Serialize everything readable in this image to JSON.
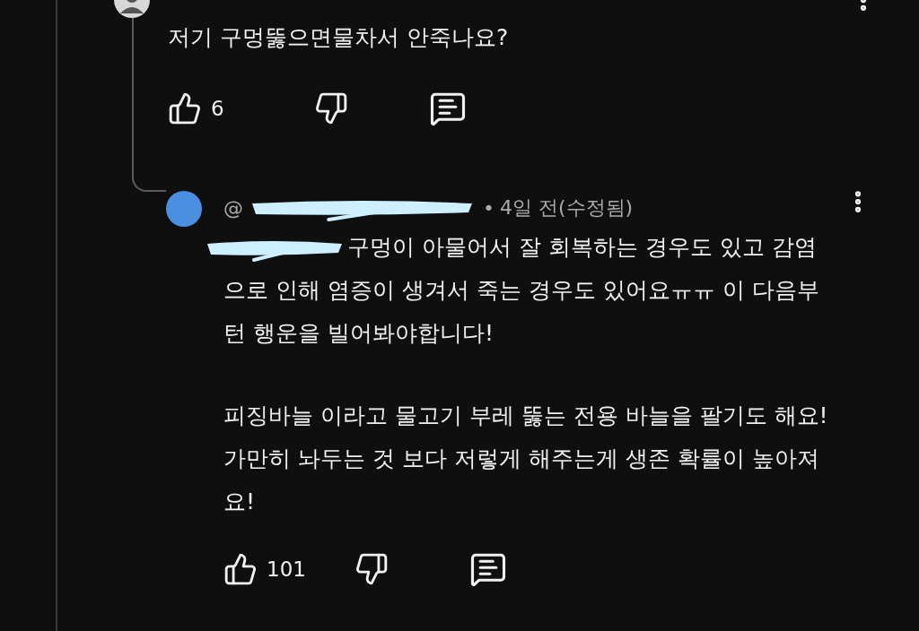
{
  "parent_comment": {
    "text": "저기 구멍뚫으면물차서 안죽나요?",
    "likes": "6"
  },
  "reply": {
    "handle": "@",
    "separator": "•",
    "time": "4일 전(수정됨)",
    "paragraphs": [
      "구멍이 아물어서 잘 회복하는 경우도 있고 감염으로 인해 염증이 생겨서 죽는 경우도 있어요ㅠㅠ 이 다음부턴 행운을 빌어봐야합니다!",
      "피징바늘 이라고 물고기 부레 뚫는 전용 바늘을 팔기도 해요! 가만히 놔두는 것 보다 저렇게 해주는게 생존 확률이 높아져요!"
    ],
    "likes": "101"
  }
}
